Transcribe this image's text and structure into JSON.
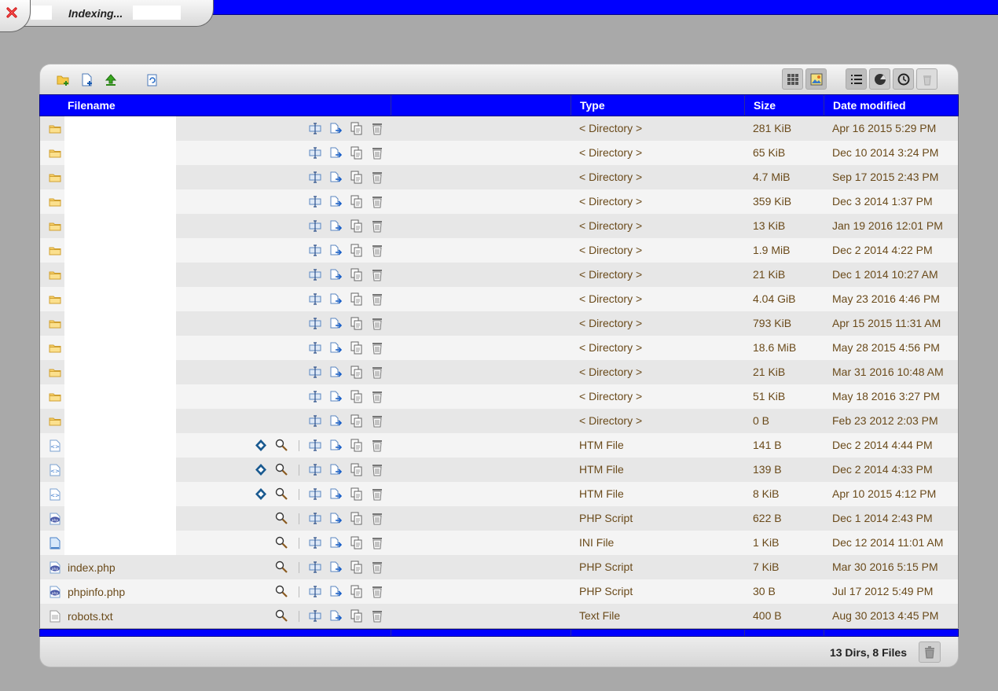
{
  "tab": {
    "title": "Indexing..."
  },
  "colors": {
    "accent": "#0000ff",
    "row_text": "#6a4a1a",
    "background": "#a9a9a9"
  },
  "toolbar": {
    "left_icons": [
      "new-folder-icon",
      "new-file-icon",
      "upload-icon",
      "refresh-icon"
    ],
    "view_icons": [
      "icon-view-icon",
      "thumbnail-view-icon"
    ],
    "mode_icons": [
      "list-view-icon",
      "pie-chart-icon",
      "history-clock-icon",
      "trash-bin-icon"
    ]
  },
  "columns": {
    "filename": "Filename",
    "type": "Type",
    "size": "Size",
    "date": "Date modified"
  },
  "rows": [
    {
      "kind": "dir",
      "name": "",
      "type": "< Directory >",
      "size": "281 KiB",
      "date": "Apr 16 2015 5:29 PM"
    },
    {
      "kind": "dir",
      "name": "",
      "type": "< Directory >",
      "size": "65 KiB",
      "date": "Dec 10 2014 3:24 PM"
    },
    {
      "kind": "dir",
      "name": "",
      "type": "< Directory >",
      "size": "4.7 MiB",
      "date": "Sep 17 2015 2:43 PM"
    },
    {
      "kind": "dir",
      "name": "",
      "type": "< Directory >",
      "size": "359 KiB",
      "date": "Dec 3 2014 1:37 PM"
    },
    {
      "kind": "dir",
      "name": "",
      "type": "< Directory >",
      "size": "13 KiB",
      "date": "Jan 19 2016 12:01 PM"
    },
    {
      "kind": "dir",
      "name": "",
      "type": "< Directory >",
      "size": "1.9 MiB",
      "date": "Dec 2 2014 4:22 PM"
    },
    {
      "kind": "dir",
      "name": "",
      "type": "< Directory >",
      "size": "21 KiB",
      "date": "Dec 1 2014 10:27 AM"
    },
    {
      "kind": "dir",
      "name": "",
      "type": "< Directory >",
      "size": "4.04 GiB",
      "date": "May 23 2016 4:46 PM"
    },
    {
      "kind": "dir",
      "name": "",
      "type": "< Directory >",
      "size": "793 KiB",
      "date": "Apr 15 2015 11:31 AM"
    },
    {
      "kind": "dir",
      "name": "",
      "type": "< Directory >",
      "size": "18.6 MiB",
      "date": "May 28 2015 4:56 PM"
    },
    {
      "kind": "dir",
      "name": "",
      "type": "< Directory >",
      "size": "21 KiB",
      "date": "Mar 31 2016 10:48 AM"
    },
    {
      "kind": "dir",
      "name": "",
      "type": "< Directory >",
      "size": "51 KiB",
      "date": "May 18 2016 3:27 PM"
    },
    {
      "kind": "dir",
      "name": "",
      "type": "< Directory >",
      "size": "0 B",
      "date": "Feb 23 2012 2:03 PM"
    },
    {
      "kind": "htm",
      "name": "",
      "type": "HTM File",
      "size": "141 B",
      "date": "Dec 2 2014 4:44 PM"
    },
    {
      "kind": "htm",
      "name": "",
      "type": "HTM File",
      "size": "139 B",
      "date": "Dec 2 2014 4:33 PM"
    },
    {
      "kind": "htm",
      "name": "",
      "type": "HTM File",
      "size": "8 KiB",
      "date": "Apr 10 2015 4:12 PM"
    },
    {
      "kind": "php",
      "name": "",
      "type": "PHP Script",
      "size": "622 B",
      "date": "Dec 1 2014 2:43 PM"
    },
    {
      "kind": "ini",
      "name": "",
      "type": "INI File",
      "size": "1 KiB",
      "date": "Dec 12 2014 11:01 AM"
    },
    {
      "kind": "php",
      "name": "index.php",
      "type": "PHP Script",
      "size": "7 KiB",
      "date": "Mar 30 2016 5:15 PM"
    },
    {
      "kind": "php",
      "name": "phpinfo.php",
      "type": "PHP Script",
      "size": "30 B",
      "date": "Jul 17 2012 5:49 PM"
    },
    {
      "kind": "txt",
      "name": "robots.txt",
      "type": "Text File",
      "size": "400 B",
      "date": "Aug 30 2013 4:45 PM"
    }
  ],
  "footer": {
    "status": "13 Dirs, 8 Files"
  }
}
